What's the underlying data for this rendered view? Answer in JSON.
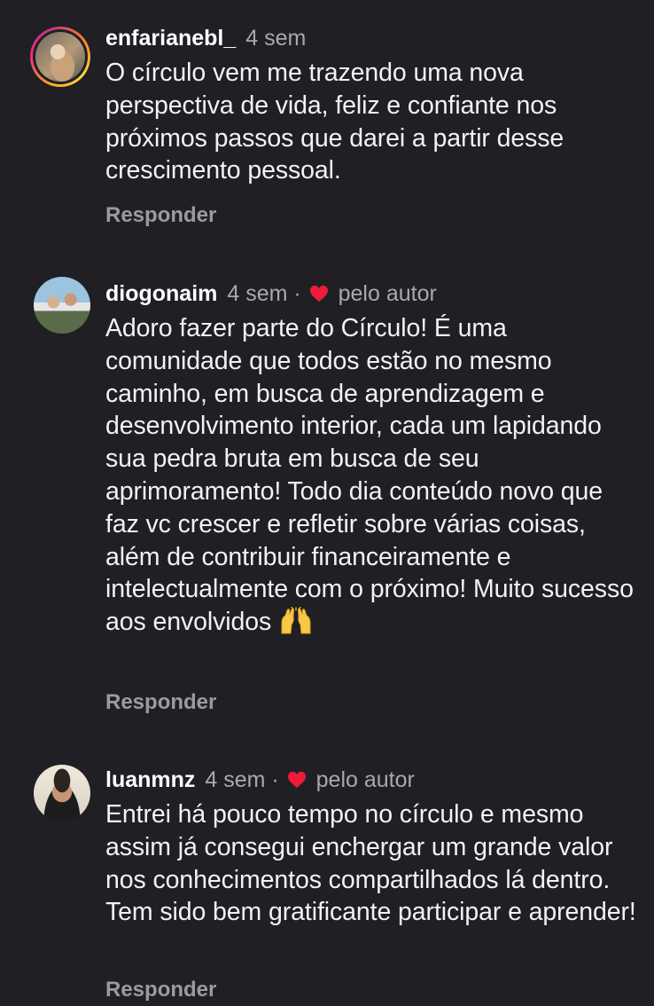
{
  "comments": [
    {
      "username": "enfarianebl_",
      "time": "4 sem",
      "liked_by_author": false,
      "text": "O círculo vem me trazendo uma nova perspectiva de vida, feliz e confiante nos próximos passos que darei a partir desse crescimento pessoal.",
      "reply_label": "Responder"
    },
    {
      "username": "diogonaim",
      "time": "4 sem",
      "separator": "·",
      "liked_by_author": true,
      "by_author_label": "pelo autor",
      "text": "Adoro fazer parte do Círculo! É uma comunidade que todos estão no mesmo caminho, em busca de aprendizagem e desenvolvimento interior, cada um lapidando sua pedra bruta em busca de seu aprimoramento! Todo dia conteúdo novo que faz vc crescer e refletir sobre várias coisas, além de contribuir financeiramente e intelectualmente com o próximo! Muito sucesso aos envolvidos",
      "emoji": "raising-hands-icon",
      "reply_label": "Responder"
    },
    {
      "username": "luanmnz",
      "time": "4 sem",
      "separator": "·",
      "liked_by_author": true,
      "by_author_label": "pelo autor",
      "text": "Entrei há pouco tempo no círculo e mesmo assim já consegui enchergar um grande valor nos conhecimentos compartilhados lá dentro. Tem sido bem gratificante participar e aprender!",
      "reply_label": "Responder"
    }
  ],
  "colors": {
    "background": "#1f1f24",
    "text": "#f2f2f2",
    "muted": "#a8a8ad",
    "heart": "#ed1c3a"
  }
}
